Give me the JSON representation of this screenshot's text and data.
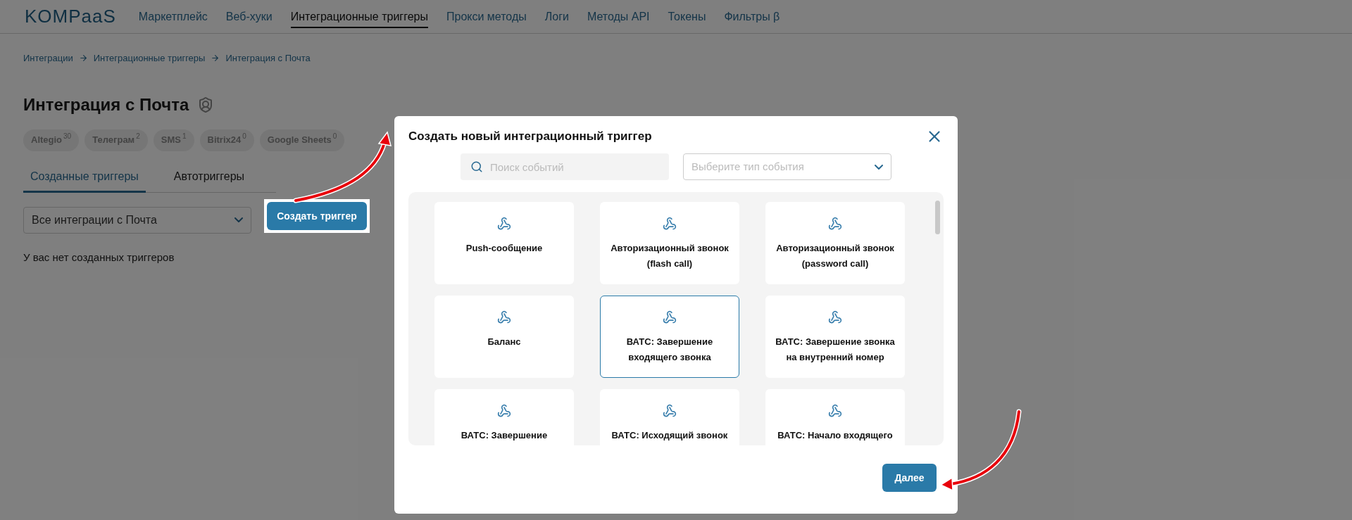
{
  "nav": {
    "logo": "KOMPaaS",
    "items": [
      {
        "label": "Маркетплейс",
        "selected": false
      },
      {
        "label": "Веб-хуки",
        "selected": false
      },
      {
        "label": "Интеграционные триггеры",
        "selected": true
      },
      {
        "label": "Прокси методы",
        "selected": false
      },
      {
        "label": "Логи",
        "selected": false
      },
      {
        "label": "Методы API",
        "selected": false
      },
      {
        "label": "Токены",
        "selected": false
      },
      {
        "label": "Фильтры β",
        "selected": false
      }
    ]
  },
  "breadcrumbs": [
    "Интеграции",
    "Интеграционные триггеры",
    "Интеграция с Почта"
  ],
  "title": "Интеграция с Почта",
  "chips": [
    {
      "label": "Altegio",
      "count": "30"
    },
    {
      "label": "Телеграм",
      "count": "2"
    },
    {
      "label": "SMS",
      "count": "1"
    },
    {
      "label": "Bitrix24",
      "count": "0"
    },
    {
      "label": "Google Sheets",
      "count": "0"
    }
  ],
  "tabs": [
    {
      "label": "Созданные триггеры",
      "selected": true
    },
    {
      "label": "Автотриггеры",
      "selected": false
    }
  ],
  "filter": {
    "value": "Все интеграции с Почта"
  },
  "create_button": "Создать триггер",
  "empty_text": "У вас нет созданных триггеров",
  "modal": {
    "title": "Создать новый интеграционный триггер",
    "search": {
      "placeholder": "Поиск событий"
    },
    "type_select": {
      "placeholder": "Выберите тип события"
    },
    "cards": [
      {
        "title": "Push-сообщение",
        "selected": false
      },
      {
        "title": "Авторизационный звонок (flash call)",
        "selected": false
      },
      {
        "title": "Авторизационный звонок (password call)",
        "selected": false
      },
      {
        "title": "Баланс",
        "selected": false
      },
      {
        "title": "ВАТС: Завершение входящего звонка",
        "selected": true
      },
      {
        "title": "ВАТС: Завершение звонка на внутренний номер",
        "selected": false
      },
      {
        "title": "ВАТС: Завершение",
        "selected": false
      },
      {
        "title": "ВАТС: Исходящий звонок",
        "selected": false
      },
      {
        "title": "ВАТС: Начало входящего",
        "selected": false
      }
    ],
    "next_button": "Далее"
  }
}
